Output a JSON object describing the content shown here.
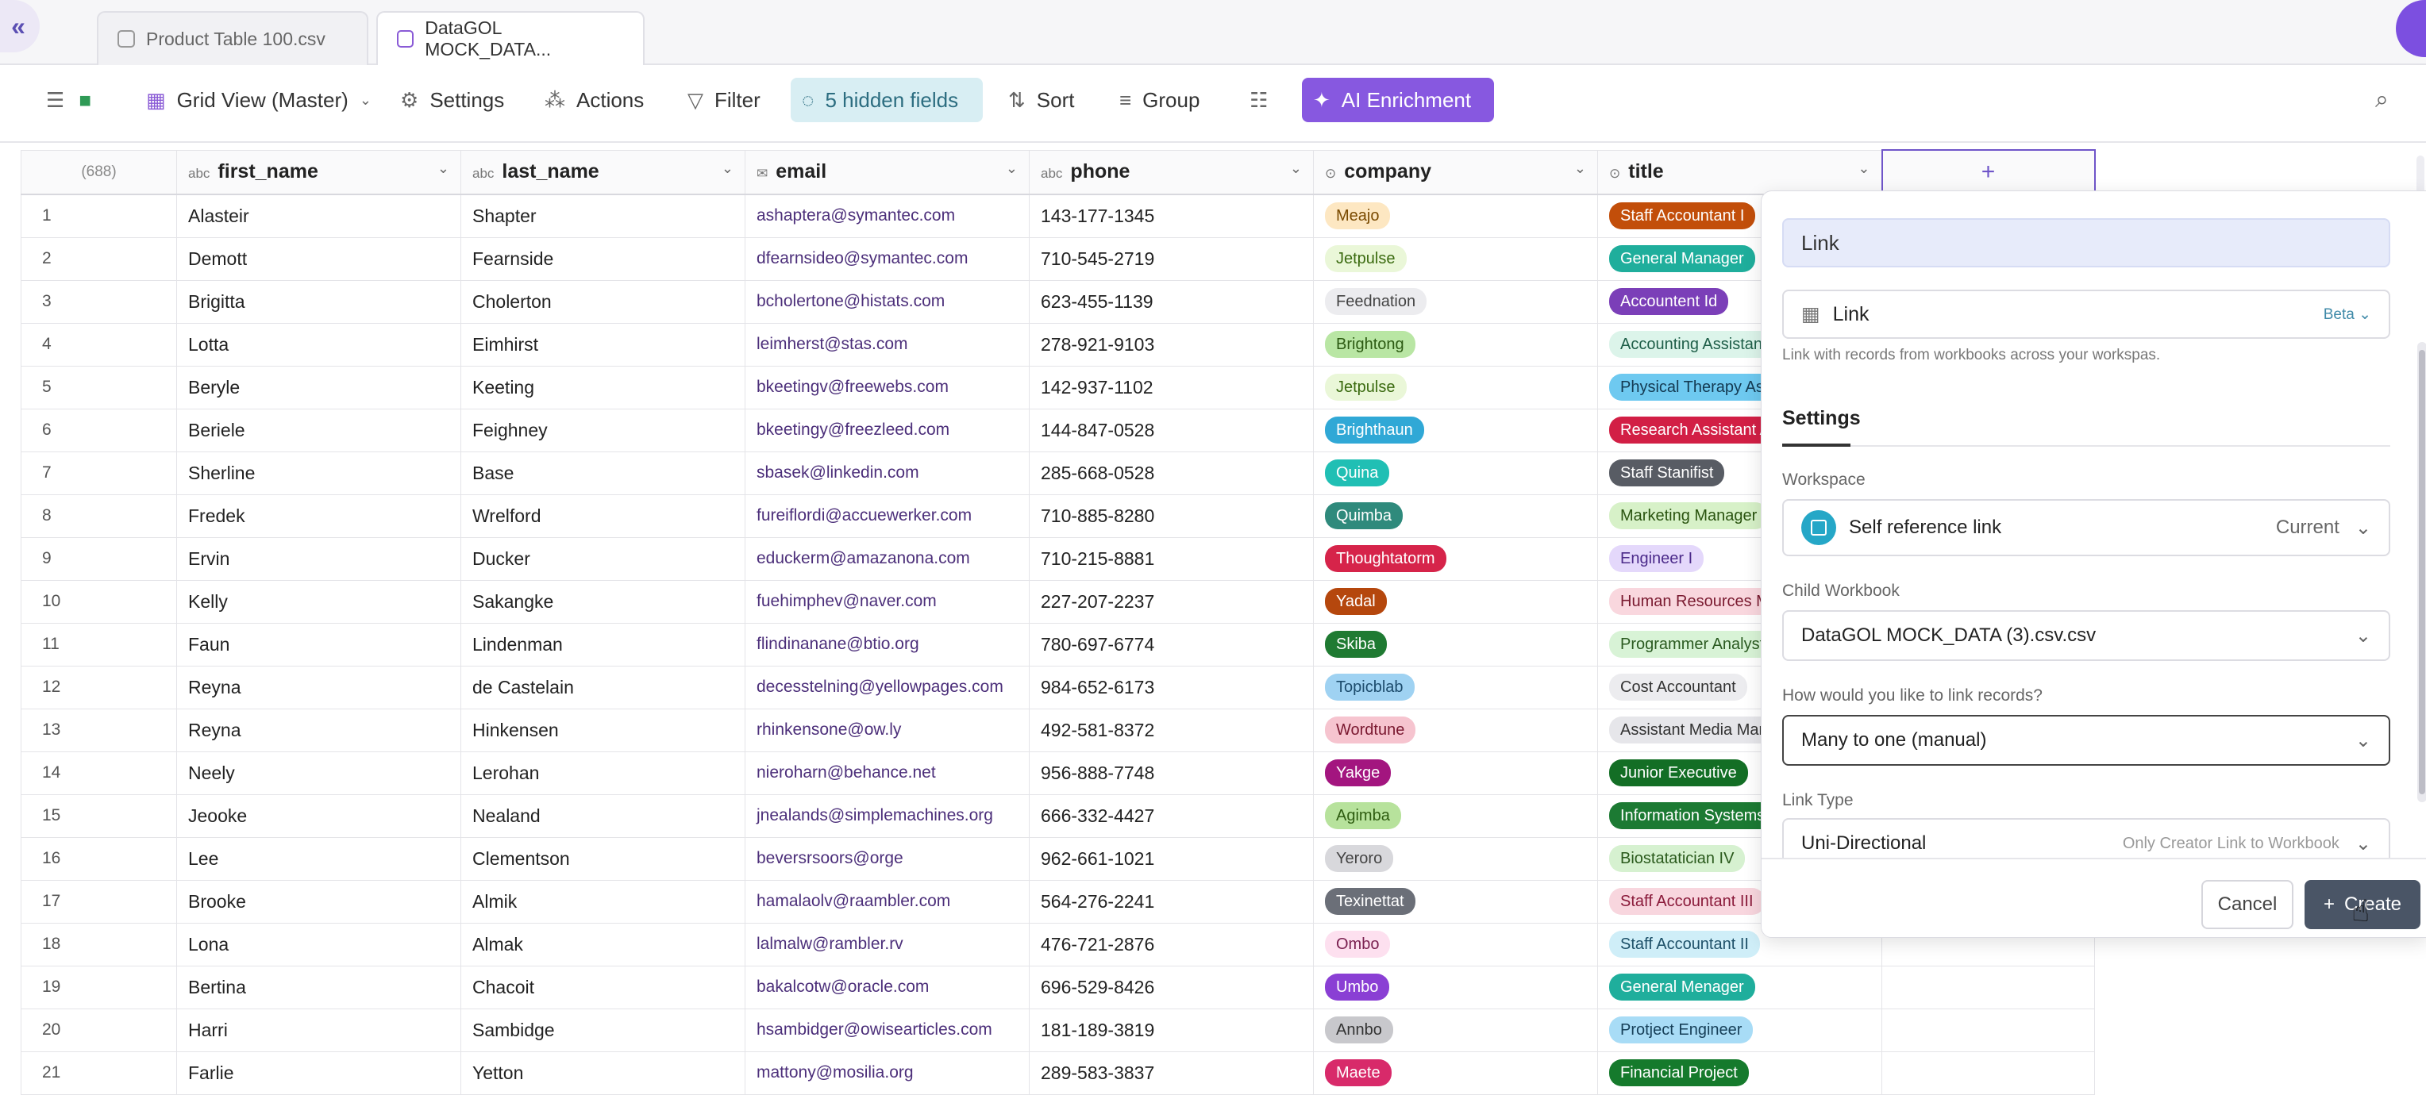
{
  "tabs": [
    {
      "label": "Product Table 100.csv",
      "active": false
    },
    {
      "label": "DataGOL MOCK_DATA...",
      "active": true
    }
  ],
  "toolbar": {
    "view_label": "Grid View (Master)",
    "settings_label": "Settings",
    "actions_label": "Actions",
    "filter_label": "Filter",
    "hidden_fields_label": "5 hidden fields",
    "sort_label": "Sort",
    "group_label": "Group",
    "ai_label": "AI Enrichment"
  },
  "grid": {
    "row_count_label": "(688)",
    "columns": [
      {
        "type": "abc",
        "name": "first_name"
      },
      {
        "type": "abc",
        "name": "last_name"
      },
      {
        "type": "✉",
        "name": "email"
      },
      {
        "type": "abc",
        "name": "phone"
      },
      {
        "type": "⊙",
        "name": "company"
      },
      {
        "type": "⊙",
        "name": "title"
      }
    ],
    "add_column_label": "+",
    "rows": [
      {
        "n": "1",
        "first": "Alasteir",
        "last": "Shapter",
        "email": "ashaptera@symantec.com",
        "phone": "143-177-1345",
        "company": "Meajo",
        "title": "Staff Accountant I"
      },
      {
        "n": "2",
        "first": "Demott",
        "last": "Fearnside",
        "email": "dfearnsideo@symantec.com",
        "phone": "710-545-2719",
        "company": "Jetpulse",
        "title": "General Manager"
      },
      {
        "n": "3",
        "first": "Brigitta",
        "last": "Cholerton",
        "email": "bcholertone@histats.com",
        "phone": "623-455-1139",
        "company": "Feednation",
        "title": "Accountent Id"
      },
      {
        "n": "4",
        "first": "Lotta",
        "last": "Eimhirst",
        "email": "leimherst@stas.com",
        "phone": "278-921-9103",
        "company": "Brightong",
        "title": "Accounting Assistant"
      },
      {
        "n": "5",
        "first": "Beryle",
        "last": "Keeting",
        "email": "bkeetingv@freewebs.com",
        "phone": "142-937-1102",
        "company": "Jetpulse",
        "title": "Physical Therapy Assistant"
      },
      {
        "n": "6",
        "first": "Beriele",
        "last": "Feighney",
        "email": "bkeetingy@freezleed.com",
        "phone": "144-847-0528",
        "company": "Brighthaun",
        "title": "Research Assistant A"
      },
      {
        "n": "7",
        "first": "Sherline",
        "last": "Base",
        "email": "sbasek@linkedin.com",
        "phone": "285-668-0528",
        "company": "Quina",
        "title": "Staff Stanifist"
      },
      {
        "n": "8",
        "first": "Fredek",
        "last": "Wrelford",
        "email": "fureiflordi@accuewerker.com",
        "phone": "710-885-8280",
        "company": "Quimba",
        "title": "Marketing Manager"
      },
      {
        "n": "9",
        "first": "Ervin",
        "last": "Ducker",
        "email": "educkerm@amazanona.com",
        "phone": "710-215-8881",
        "company": "Thoughtatorm",
        "title": "Engineer I"
      },
      {
        "n": "10",
        "first": "Kelly",
        "last": "Sakangke",
        "email": "fuehimphev@naver.com",
        "phone": "227-207-2237",
        "company": "Yadal",
        "title": "Human Resources Manager"
      },
      {
        "n": "11",
        "first": "Faun",
        "last": "Lindenman",
        "email": "flindinanane@btio.org",
        "phone": "780-697-6774",
        "company": "Skiba",
        "title": "Programmer Analyst"
      },
      {
        "n": "12",
        "first": "Reyna",
        "last": "de Castelain",
        "email": "decesstelning@yellowpages.com",
        "phone": "984-652-6173",
        "company": "Topicblab",
        "title": "Cost Accountant"
      },
      {
        "n": "13",
        "first": "Reyna",
        "last": "Hinkensen",
        "email": "rhinkensone@ow.ly",
        "phone": "492-581-8372",
        "company": "Wordtune",
        "title": "Assistant Media Manager"
      },
      {
        "n": "14",
        "first": "Neely",
        "last": "Lerohan",
        "email": "nieroharn@behance.net",
        "phone": "956-888-7748",
        "company": "Yakge",
        "title": "Junior Executive"
      },
      {
        "n": "15",
        "first": "Jeooke",
        "last": "Nealand",
        "email": "jnealands@simplemachines.org",
        "phone": "666-332-4427",
        "company": "Agimba",
        "title": "Information Systems Manager"
      },
      {
        "n": "16",
        "first": "Lee",
        "last": "Clementson",
        "email": "beversrsoors@orge",
        "phone": "962-661-1021",
        "company": "Yeroro",
        "title": "Biostatatician IV"
      },
      {
        "n": "17",
        "first": "Brooke",
        "last": "Almik",
        "email": "hamalaolv@raambler.com",
        "phone": "564-276-2241",
        "company": "Texinettat",
        "title": "Staff Accountant III"
      },
      {
        "n": "18",
        "first": "Lona",
        "last": "Almak",
        "email": "lalmalw@rambler.rv",
        "phone": "476-721-2876",
        "company": "Ombo",
        "title": "Staff Accountant II"
      },
      {
        "n": "19",
        "first": "Bertina",
        "last": "Chacoit",
        "email": "bakalcotw@oracle.com",
        "phone": "696-529-8426",
        "company": "Umbo",
        "title": "General Menager"
      },
      {
        "n": "20",
        "first": "Harri",
        "last": "Sambidge",
        "email": "hsambidger@owisearticles.com",
        "phone": "181-189-3819",
        "company": "Annbo",
        "title": "Protject Engineer"
      },
      {
        "n": "21",
        "first": "Farlie",
        "last": "Yetton",
        "email": "mattony@mosilia.org",
        "phone": "289-583-3837",
        "company": "Maete",
        "title": "Financial Project"
      }
    ]
  },
  "panel": {
    "field_name": "Link",
    "field_type": "Link",
    "field_type_badge": "Beta",
    "help_text": "Link with records from workbooks across your workspas.",
    "settings_heading": "Settings",
    "workspace_label": "Workspace",
    "workspace_value": "Self reference link",
    "workspace_tag": "Current",
    "child_workbook_label": "Child Workbook",
    "child_workbook_value": "DataGOL MOCK_DATA (3).csv.csv",
    "link_question": "How would you like to link records?",
    "link_mode_value": "Many to one (manual)",
    "link_type_label": "Link Type",
    "link_type_value": "Uni-Directional",
    "link_type_hint": "Only Creator Link to Workbook",
    "cancel_label": "Cancel",
    "create_label": "Create"
  },
  "colors": {
    "accent": "#8758e0",
    "hidden_fields_bg": "#d8eef3",
    "create_button": "#4a5566"
  }
}
